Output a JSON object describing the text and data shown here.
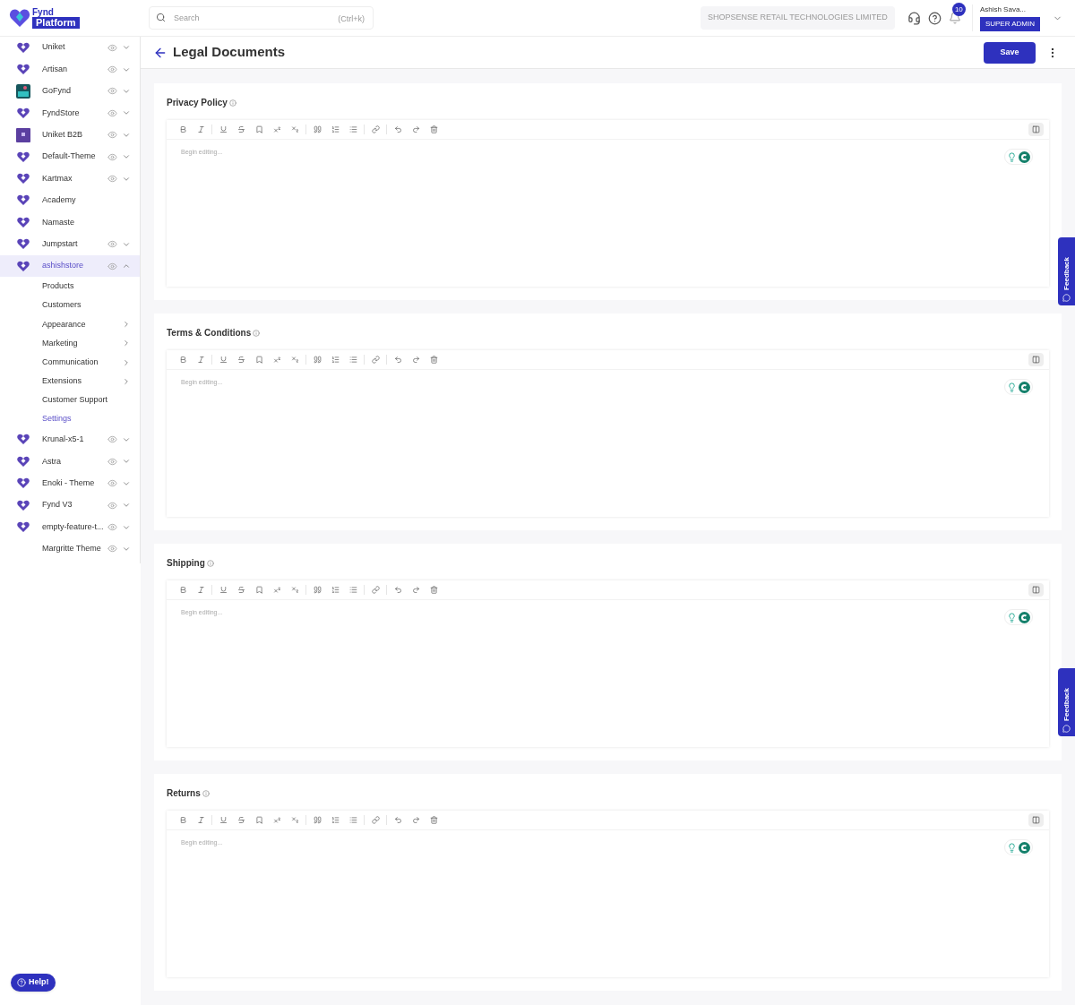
{
  "header": {
    "logo_top": "Fynd",
    "logo_bottom": "Platform",
    "search": {
      "placeholder": "Search",
      "shortcut": "(Ctrl+k)"
    },
    "company": "SHOPSENSE RETAIL TECHNOLOGIES LIMITED",
    "notifications": "10",
    "user": "Ashish Sava...",
    "role": "SUPER ADMIN"
  },
  "sidebar": {
    "items": [
      {
        "name": "Uniket",
        "kind": "heart",
        "eye": true,
        "expanded": false,
        "selected": false
      },
      {
        "name": "Artisan",
        "kind": "heart",
        "eye": true,
        "expanded": false,
        "selected": false
      },
      {
        "name": "GoFynd",
        "kind": "tile",
        "eye": true,
        "expanded": false,
        "selected": false
      },
      {
        "name": "FyndStore",
        "kind": "heart",
        "eye": true,
        "expanded": false,
        "selected": false
      },
      {
        "name": "Uniket B2B",
        "kind": "square",
        "eye": true,
        "expanded": false,
        "selected": false
      },
      {
        "name": "Default-Theme",
        "kind": "heart",
        "eye": true,
        "expanded": false,
        "selected": false
      },
      {
        "name": "Kartmax",
        "kind": "heart",
        "eye": true,
        "expanded": false,
        "selected": false
      },
      {
        "name": "Academy",
        "kind": "heart",
        "eye": false,
        "selected": false
      },
      {
        "name": "Namaste",
        "kind": "heart",
        "eye": false,
        "selected": false
      },
      {
        "name": "Jumpstart",
        "kind": "heart",
        "eye": true,
        "expanded": false,
        "selected": false
      },
      {
        "name": "ashishstore",
        "kind": "heart",
        "eye": true,
        "expanded": true,
        "selected": true,
        "children": [
          {
            "name": "Products",
            "submenu": false,
            "selected": false
          },
          {
            "name": "Customers",
            "submenu": false,
            "selected": false
          },
          {
            "name": "Appearance",
            "submenu": true,
            "selected": false
          },
          {
            "name": "Marketing",
            "submenu": true,
            "selected": false
          },
          {
            "name": "Communication",
            "submenu": true,
            "selected": false
          },
          {
            "name": "Extensions",
            "submenu": true,
            "selected": false
          },
          {
            "name": "Customer Support",
            "submenu": false,
            "selected": false
          },
          {
            "name": "Settings",
            "submenu": false,
            "selected": true
          }
        ]
      },
      {
        "name": "Krunal-x5-1",
        "kind": "heart",
        "eye": true,
        "expanded": false,
        "selected": false
      },
      {
        "name": "Astra",
        "kind": "heart",
        "eye": true,
        "expanded": false,
        "selected": false
      },
      {
        "name": "Enoki - Theme",
        "kind": "heart",
        "eye": true,
        "expanded": false,
        "selected": false
      },
      {
        "name": "Fynd V3",
        "kind": "heart",
        "eye": true,
        "expanded": false,
        "selected": false
      },
      {
        "name": "empty-feature-t...",
        "kind": "heart",
        "eye": true,
        "expanded": false,
        "selected": false
      },
      {
        "name": "Margritte Theme",
        "kind": "none",
        "eye": true,
        "expanded": false,
        "selected": false
      }
    ]
  },
  "page": {
    "title": "Legal Documents",
    "save": "Save"
  },
  "sections": [
    {
      "title": "Privacy Policy",
      "placeholder": "Begin editing..."
    },
    {
      "title": "Terms & Conditions",
      "placeholder": "Begin editing..."
    },
    {
      "title": "Shipping",
      "placeholder": "Begin editing..."
    },
    {
      "title": "Returns",
      "placeholder": "Begin editing..."
    }
  ],
  "feedback_tabs": [
    "Feedback",
    "Feedback"
  ],
  "help": "Help!"
}
